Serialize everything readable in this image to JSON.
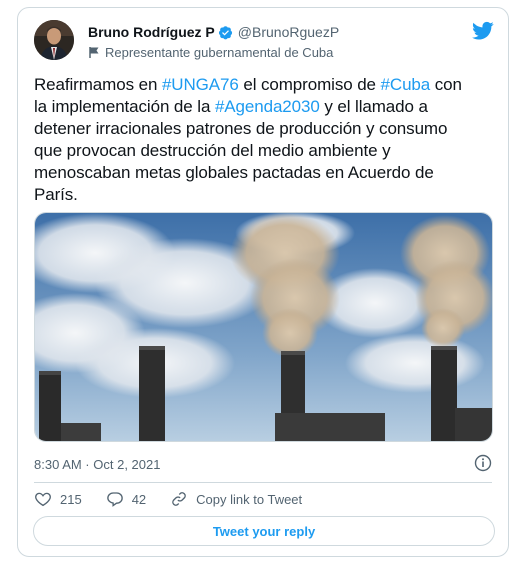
{
  "author": {
    "display_name": "Bruno Rodríguez P",
    "handle": "@BrunoRguezP",
    "label": "Representante gubernamental de Cuba",
    "verified_icon": "verified-badge-icon"
  },
  "tweet": {
    "lines": [
      [
        {
          "t": "Reafirmamos en "
        },
        {
          "t": "#UNGA76",
          "tag": true
        },
        {
          "t": " el compromiso de "
        },
        {
          "t": "#Cuba",
          "tag": true
        },
        {
          "t": " con"
        }
      ],
      [
        {
          "t": "la implementación de la "
        },
        {
          "t": "#Agenda2030",
          "tag": true
        },
        {
          "t": " y el llamado a"
        }
      ],
      [
        {
          "t": "detener irracionales patrones de producción y consumo"
        }
      ],
      [
        {
          "t": "que provocan destrucción del medio ambiente y"
        }
      ],
      [
        {
          "t": "menoscaban metas globales pactadas en Acuerdo de"
        }
      ],
      [
        {
          "t": "París."
        }
      ]
    ]
  },
  "meta": {
    "timestamp": "8:30 AM · Oct 2, 2021"
  },
  "actions": {
    "likes": "215",
    "replies": "42",
    "copy_link": "Copy link to Tweet"
  },
  "reply_button": "Tweet your reply",
  "colors": {
    "accent": "#1d9bf0",
    "text": "#0f1419",
    "muted": "#536471",
    "border": "#cfd9de"
  }
}
